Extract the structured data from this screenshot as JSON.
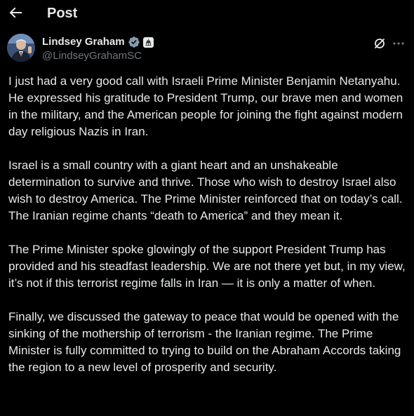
{
  "header": {
    "title": "Post",
    "back_icon": "arrow-left-icon"
  },
  "author": {
    "display_name": "Lindsey Graham",
    "handle": "@LindseyGrahamSC",
    "verified_icon": "verified-badge-icon",
    "verified_color": "#829aab",
    "affiliation_icon": "government-affiliation-icon"
  },
  "actions": {
    "grok_icon": "grok-icon",
    "more_icon": "more-horizontal-icon"
  },
  "tweet": {
    "paragraphs": [
      "I just had a very good call with Israeli Prime Minister Benjamin Netanyahu. He expressed his gratitude to President Trump, our brave men and women in the military, and the American people for joining the fight against modern day religious Nazis in Iran.",
      "Israel is a small country with a giant heart and an unshakeable determination to survive and thrive. Those who wish to destroy Israel also wish to destroy America. The Prime Minister reinforced that on today’s call. The Iranian regime chants “death to America” and they mean it.",
      "The Prime Minister spoke glowingly of the support President Trump has provided and his steadfast leadership. We are not there yet but, in my view, it’s not if this terrorist regime falls in Iran — it is only a matter of when.",
      "Finally, we discussed the gateway to peace that would be opened with the sinking of the mothership of terrorism - the Iranian regime. The Prime Minister is fully committed to trying to build on the Abraham Accords taking the region to a new level of prosperity and security."
    ]
  },
  "colors": {
    "background": "#000000",
    "text_primary": "#e7e9ea",
    "text_secondary": "#71767b"
  }
}
